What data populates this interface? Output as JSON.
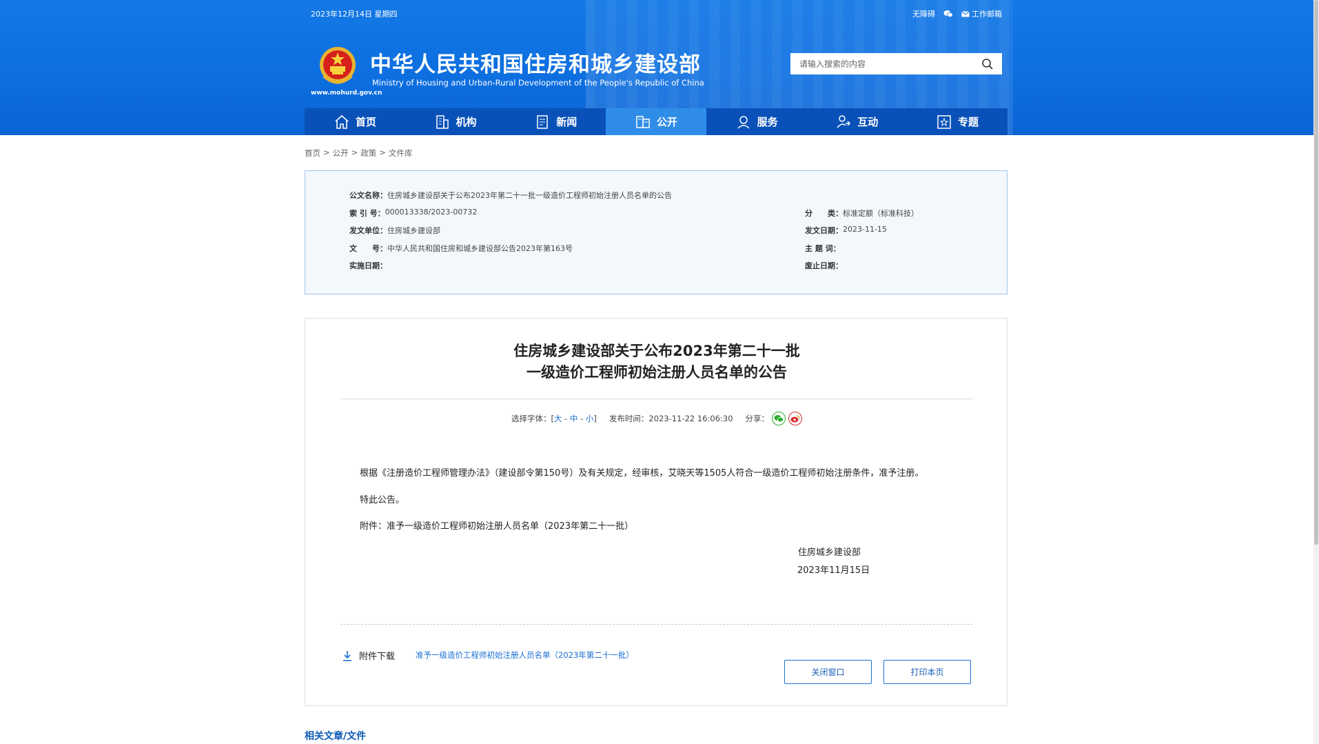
{
  "topbar": {
    "date": "2023年12月14日 星期四",
    "accessibility": "无障碍",
    "wechat_icon": "wechat-icon",
    "mail": "工作邮箱"
  },
  "header": {
    "title": "中华人民共和国住房和城乡建设部",
    "subtitle": "Ministry of Housing and Urban-Rural Development of the People's Republic of China",
    "url": "www.mohurd.gov.cn"
  },
  "search": {
    "placeholder": "请输入搜索的内容"
  },
  "nav": {
    "items": [
      {
        "label": "首页",
        "icon": "home-icon"
      },
      {
        "label": "机构",
        "icon": "building-icon"
      },
      {
        "label": "新闻",
        "icon": "news-icon"
      },
      {
        "label": "公开",
        "icon": "disclosure-icon"
      },
      {
        "label": "服务",
        "icon": "service-icon"
      },
      {
        "label": "互动",
        "icon": "interaction-icon"
      },
      {
        "label": "专题",
        "icon": "topic-icon"
      }
    ],
    "active": "公开"
  },
  "breadcrumb": [
    "首页",
    "公开",
    "政策",
    "文件库"
  ],
  "breadcrumb_sep": ">",
  "meta": {
    "doc_name_k": "公文名称：",
    "doc_name_v": "住房城乡建设部关于公布2023年第二十一批一级造价工程师初始注册人员名单的公告",
    "index_k": "索 引 号：",
    "index_v": "000013338/2023-00732",
    "category_k": "分　　类：",
    "category_v": "标准定额（标准科技）",
    "issuer_k": "发文单位：",
    "issuer_v": "住房城乡建设部",
    "issue_date_k": "发文日期：",
    "issue_date_v": "2023-11-15",
    "doc_no_k": "文　　号：",
    "doc_no_v": "中华人民共和国住房和城乡建设部公告2023年第163号",
    "subject_k": "主 题 词：",
    "subject_v": "",
    "effective_k": "实施日期：",
    "effective_v": "",
    "abolish_k": "废止日期：",
    "abolish_v": ""
  },
  "article": {
    "title_line1": "住房城乡建设部关于公布2023年第二十一批",
    "title_line2": "一级造价工程师初始注册人员名单的公告",
    "font_label": "选择字体：[",
    "font_large": "大",
    "font_medium": "中",
    "font_small": "小",
    "font_close": "]",
    "publish_time": "发布时间：2023-11-22 16:06:30",
    "share_label": "分享：",
    "para1": "根据《注册造价工程师管理办法》（建设部令第150号）及有关规定，经审核，艾晓天等1505人符合一级造价工程师初始注册条件，准予注册。",
    "para2": "特此公告。",
    "para3": "附件：准予一级造价工程师初始注册人员名单（2023年第二十一批）",
    "sign_org": "住房城乡建设部",
    "sign_date": "2023年11月15日",
    "attach_label": "附件下载",
    "attach_link": "准予一级造价工程师初始注册人员名单（2023年第二十一批）",
    "close_btn": "关闭窗口",
    "print_btn": "打印本页"
  },
  "related": {
    "heading": "相关文章/文件"
  },
  "colors": {
    "header_blue": "#0d6fe0",
    "nav_blue": "#0951b8",
    "nav_active": "#2f8de8",
    "link_blue": "#1a6fd3"
  }
}
